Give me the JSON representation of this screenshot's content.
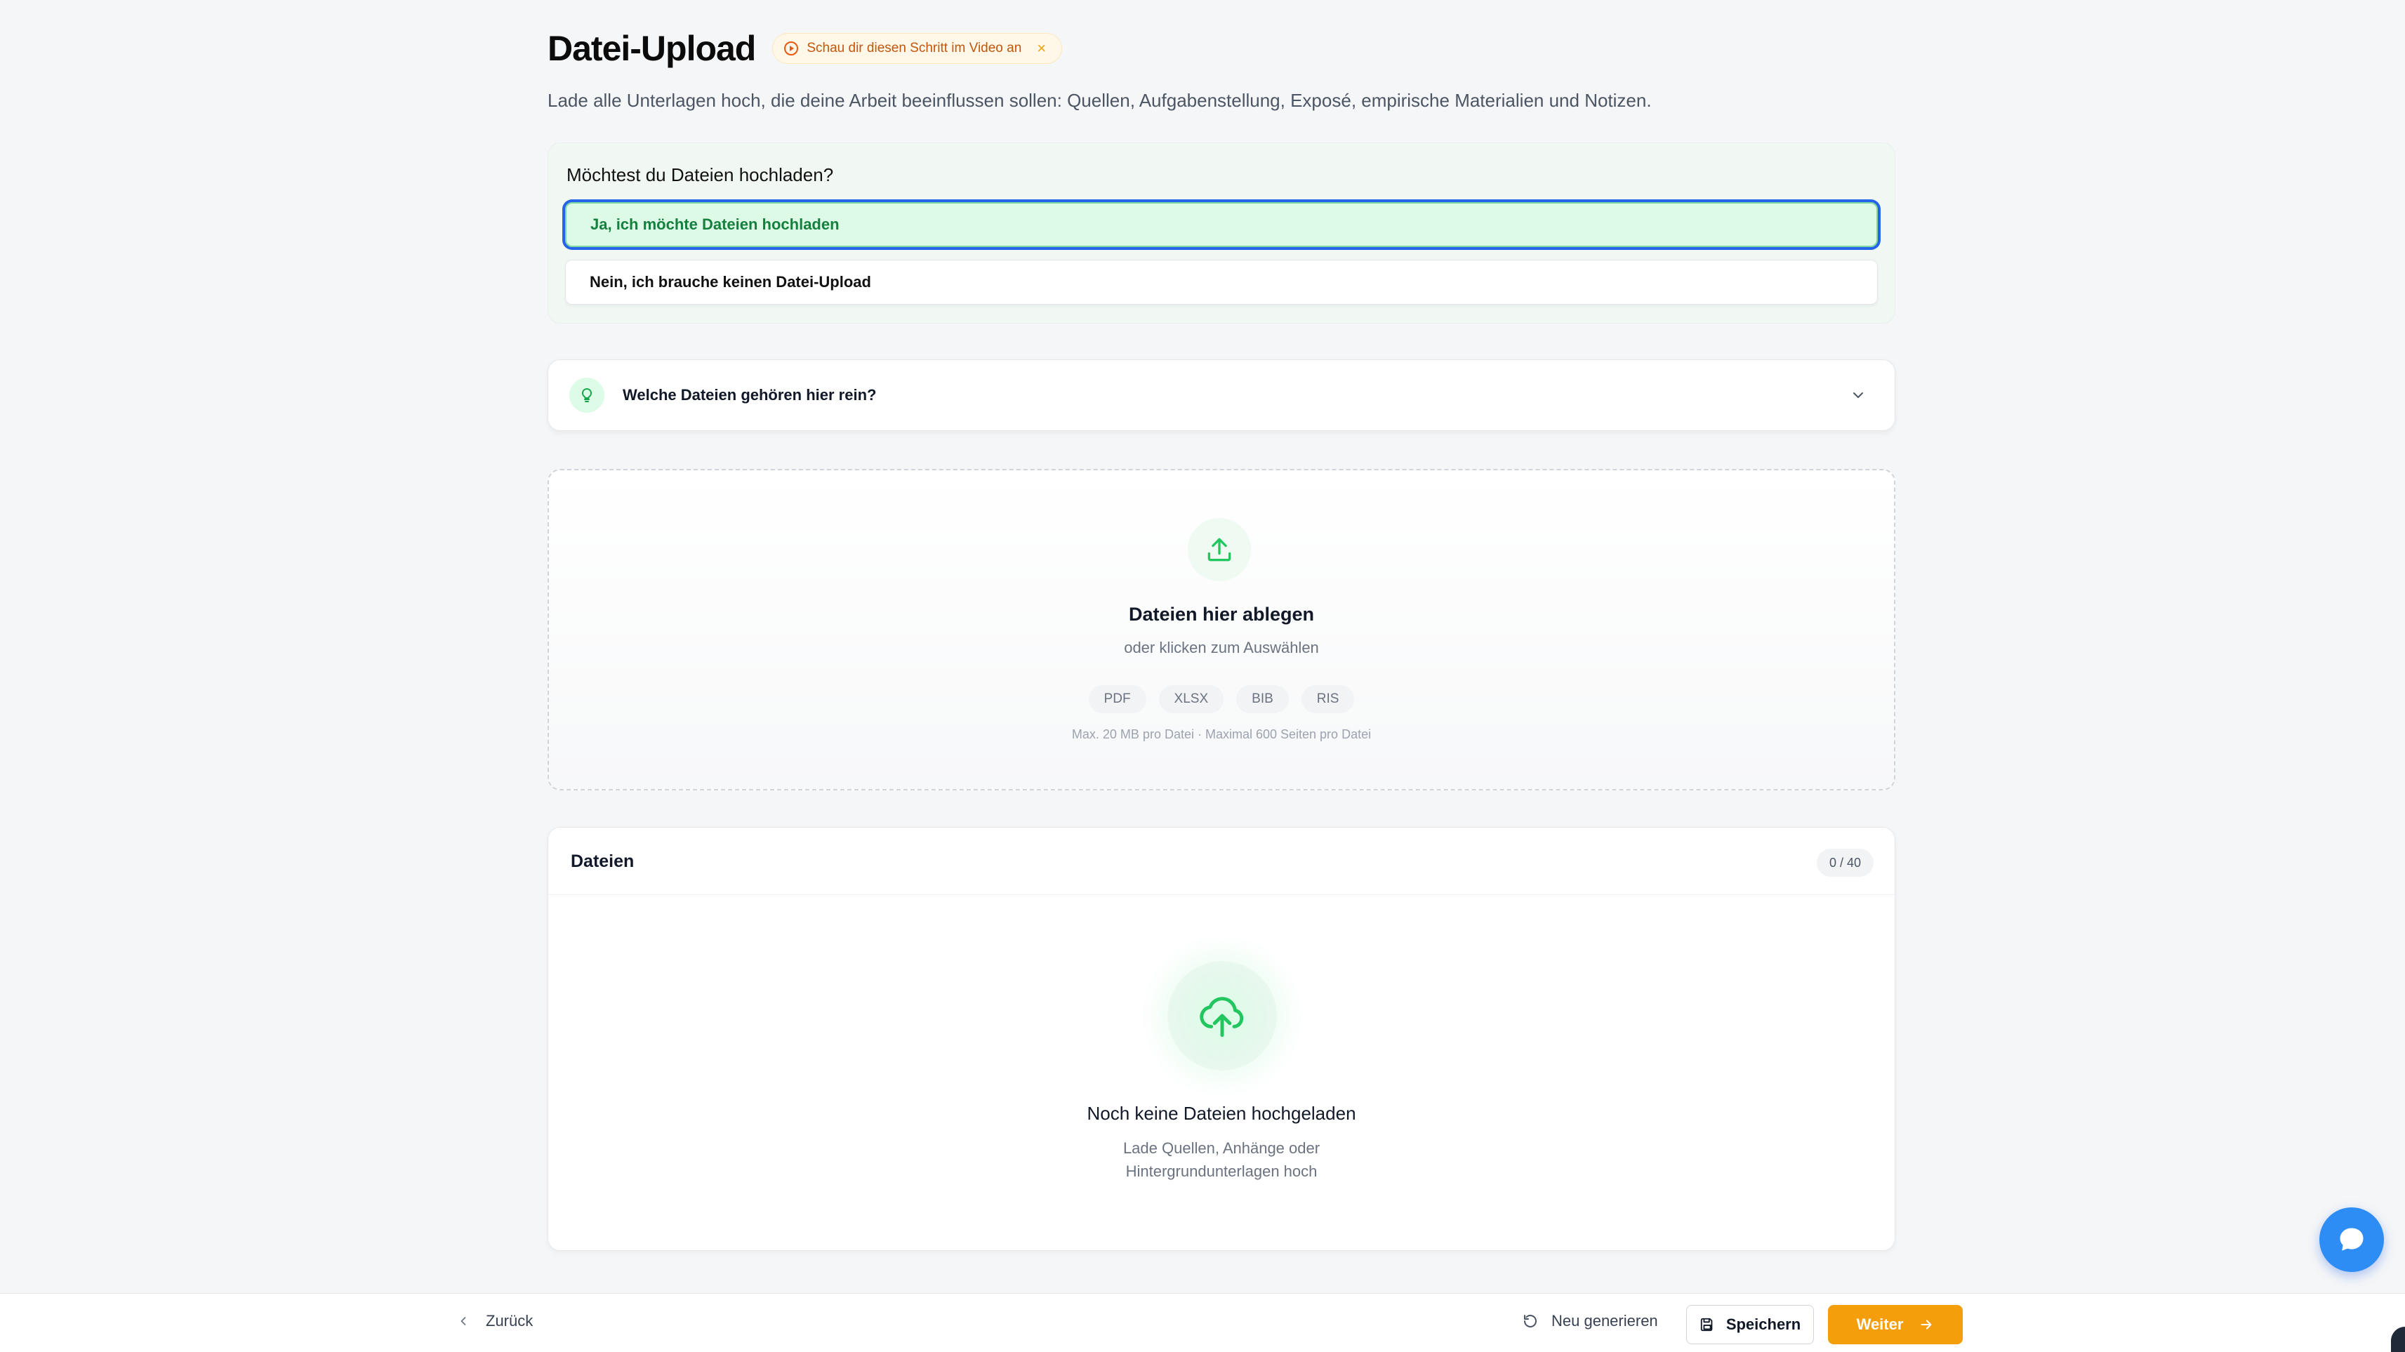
{
  "header": {
    "title": "Datei-Upload",
    "video_chip": "Schau dir diesen Schritt im Video an",
    "subtitle": "Lade alle Unterlagen hoch, die deine Arbeit beeinflussen sollen: Quellen, Aufgabenstellung, Exposé, empirische Materialien und Notizen."
  },
  "question": {
    "title": "Möchtest du Dateien hochladen?",
    "options": [
      {
        "label": "Ja, ich möchte Dateien hochladen",
        "selected": true
      },
      {
        "label": "Nein, ich brauche keinen Datei-Upload",
        "selected": false
      }
    ]
  },
  "hint": {
    "label": "Welche Dateien gehören hier rein?"
  },
  "dropzone": {
    "title": "Dateien hier ablegen",
    "subtitle": "oder klicken zum Auswählen",
    "formats": [
      "PDF",
      "XLSX",
      "BIB",
      "RIS"
    ],
    "limit": "Max. 20 MB pro Datei · Maximal 600 Seiten pro Datei"
  },
  "files": {
    "title": "Dateien",
    "count": "0 / 40",
    "empty_title": "Noch keine Dateien hochgeladen",
    "empty_sub_line1": "Lade Quellen, Anhänge oder",
    "empty_sub_line2": "Hintergrundunterlagen hoch"
  },
  "footer": {
    "back": "Zurück",
    "regenerate": "Neu generieren",
    "save": "Speichern",
    "next": "Weiter"
  },
  "colors": {
    "accent_green": "#15803d",
    "selected_bg": "#dcfae6",
    "focus_ring": "#2563eb",
    "primary_orange": "#f59e0b",
    "chat_blue": "#2e8df4"
  }
}
